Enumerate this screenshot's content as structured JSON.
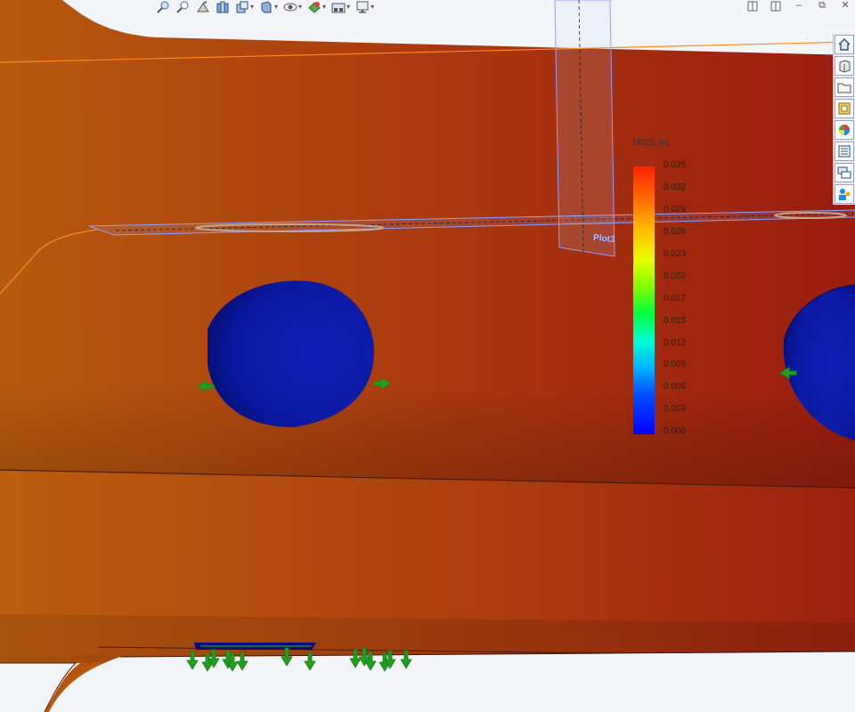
{
  "legend": {
    "title": "URES (in)",
    "labels": [
      "0.035",
      "0.032",
      "0.029",
      "0.026",
      "0.023",
      "0.020",
      "0.017",
      "0.015",
      "0.012",
      "0.009",
      "0.006",
      "0.003",
      "0.000"
    ]
  },
  "probe_tag": "Plot3",
  "colors": {
    "max_color": "#ff2200",
    "min_color": "#0000ff",
    "part_color": "#b2440f",
    "load_arrow_color": "#1fa01f"
  },
  "toolbar": {
    "icons": [
      "zoom-to-fit-icon",
      "zoom-to-area-icon",
      "previous-view-icon",
      "section-view-icon",
      "view-orientation-icon",
      "display-style-icon",
      "hide-show-items-icon",
      "edit-appearance-icon",
      "apply-scene-icon",
      "view-settings-icon"
    ]
  },
  "window_controls": {
    "minimize": "–",
    "restore": "⧉",
    "close": "✕"
  },
  "taskpane": {
    "tabs": [
      "home-icon",
      "3d-part-icon",
      "folder-icon",
      "design-library-icon",
      "appearances-icon",
      "custom-properties-icon",
      "forum-icon",
      "resources-icon"
    ]
  }
}
